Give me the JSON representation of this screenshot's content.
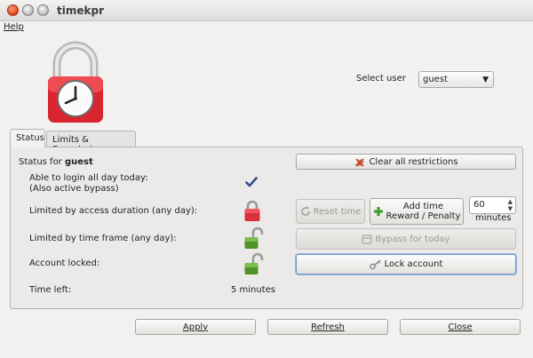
{
  "window": {
    "title": "timekpr"
  },
  "menu": {
    "help": "Help"
  },
  "user": {
    "label": "Select user",
    "selected": "guest"
  },
  "tabs": [
    {
      "label": "Status",
      "active": true
    },
    {
      "label": "Limits & Boundaries",
      "active": false
    }
  ],
  "status": {
    "title_prefix": "Status for ",
    "title_user": "guest",
    "rows": [
      {
        "label_line1": "Able to login all day today:",
        "label_line2": "(Also active bypass)",
        "icon": "checkmark-icon"
      },
      {
        "label": "Limited by access duration (any day):",
        "icon": "locked-padlock-icon"
      },
      {
        "label": "Limited by time frame (any day):",
        "icon": "unlocked-padlock-icon"
      },
      {
        "label": "Account locked:",
        "icon": "unlocked-padlock-icon"
      },
      {
        "label": "Time left:",
        "value": "5 minutes"
      }
    ]
  },
  "buttons": {
    "clear_all": "Clear all restrictions",
    "reset_time": "Reset time",
    "add_time_line1": "Add time",
    "add_time_line2": "Reward / Penalty",
    "bypass_today": "Bypass for today",
    "lock_account": "Lock account",
    "apply": "Apply",
    "refresh": "Refresh",
    "close": "Close"
  },
  "add_time": {
    "value": "60",
    "unit": "minutes"
  },
  "colors": {
    "lock_red": "#e0313a",
    "lock_green": "#5c9e2e",
    "focus_blue": "#6f93c4"
  }
}
